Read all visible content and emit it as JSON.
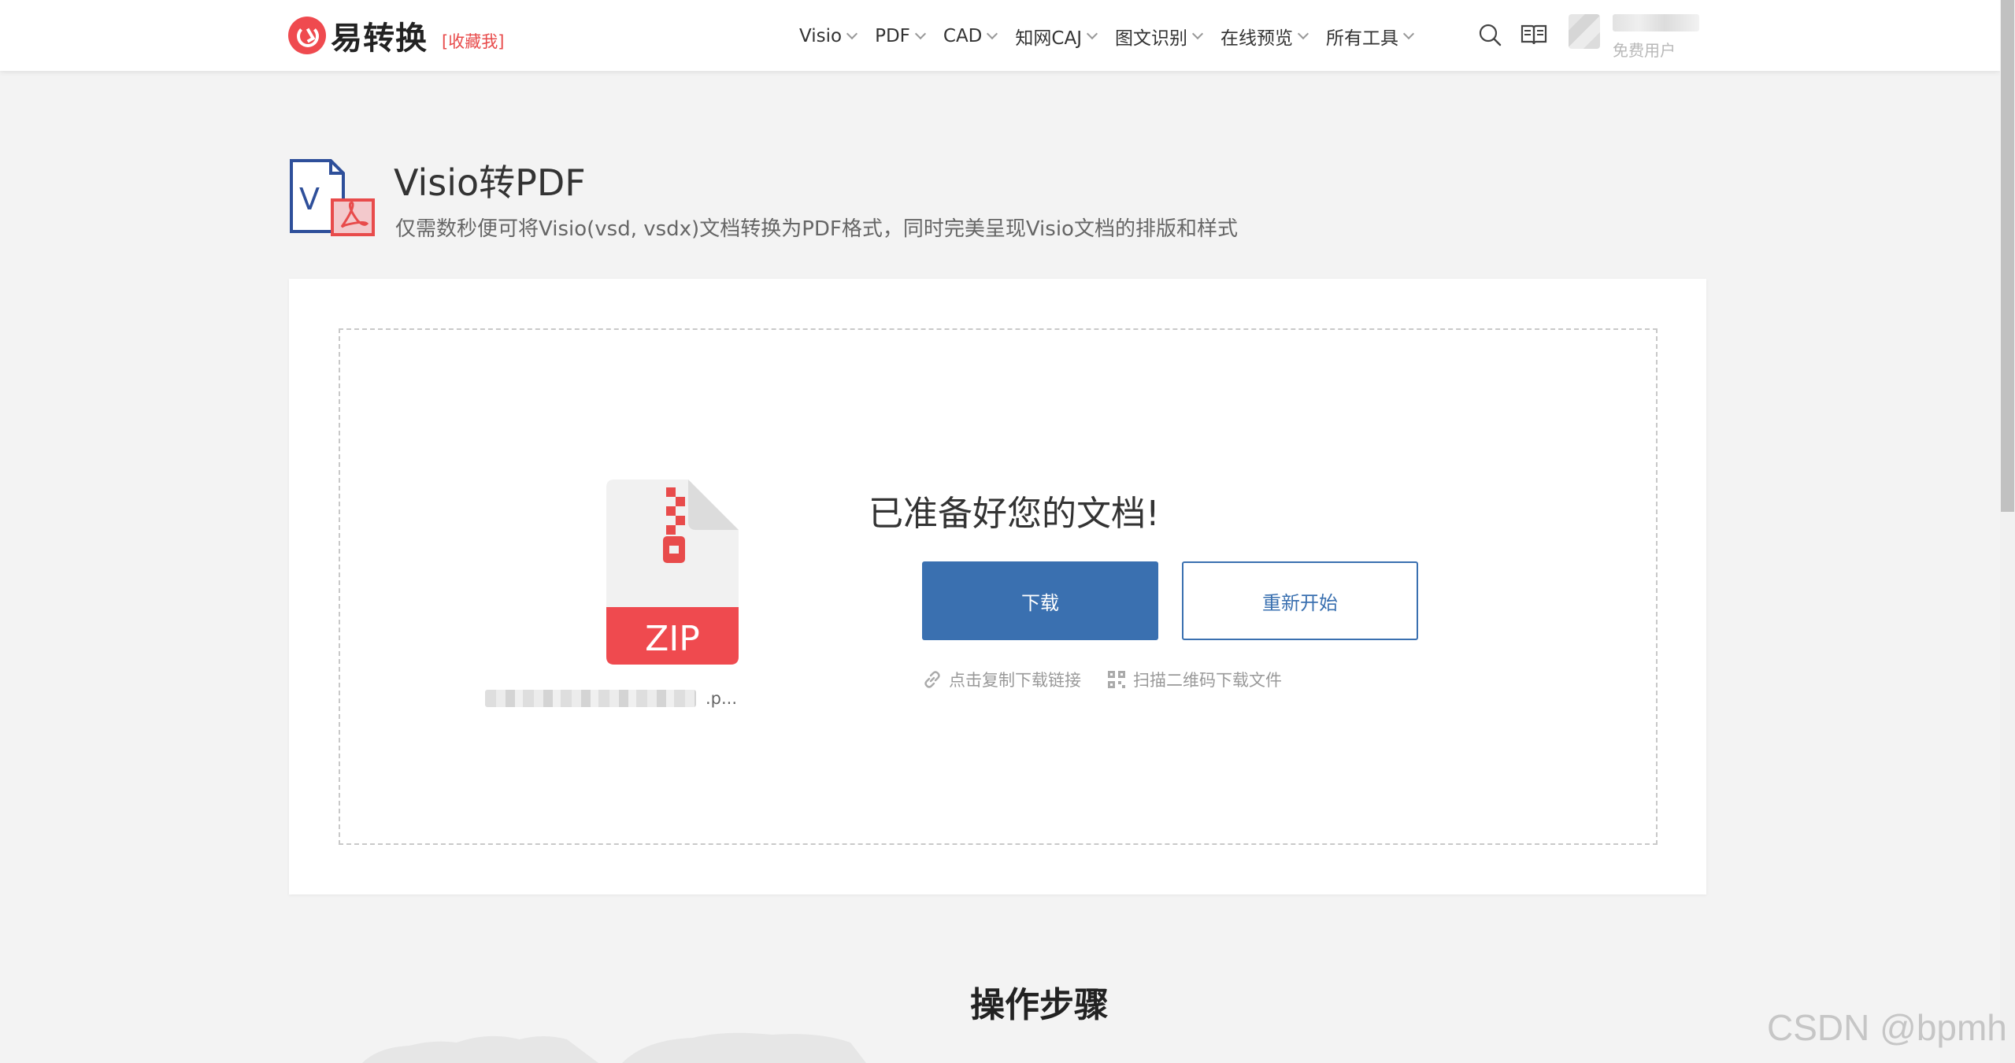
{
  "header": {
    "brand": "易转换",
    "bookmark": "[收藏我]",
    "nav": [
      {
        "label": "Visio"
      },
      {
        "label": "PDF"
      },
      {
        "label": "CAD"
      },
      {
        "label": "知网CAJ"
      },
      {
        "label": "图文识别"
      },
      {
        "label": "在线预览"
      },
      {
        "label": "所有工具"
      }
    ],
    "user_label": "免费用户"
  },
  "tool": {
    "title": "Visio转PDF",
    "description": "仅需数秒便可将Visio(vsd, vsdx)文档转换为PDF格式，同时完美呈现Visio文档的排版和样式"
  },
  "result": {
    "file_type": "ZIP",
    "file_ext": ".p...",
    "ready_text": "已准备好您的文档!",
    "download_label": "下载",
    "restart_label": "重新开始",
    "copy_link_label": "点击复制下载链接",
    "qr_label": "扫描二维码下载文件"
  },
  "steps": {
    "title": "操作步骤"
  },
  "watermark": "CSDN @bpmh",
  "colors": {
    "brand_red": "#ef4a4f",
    "primary_blue": "#3a70b0",
    "background": "#f3f3f3"
  }
}
